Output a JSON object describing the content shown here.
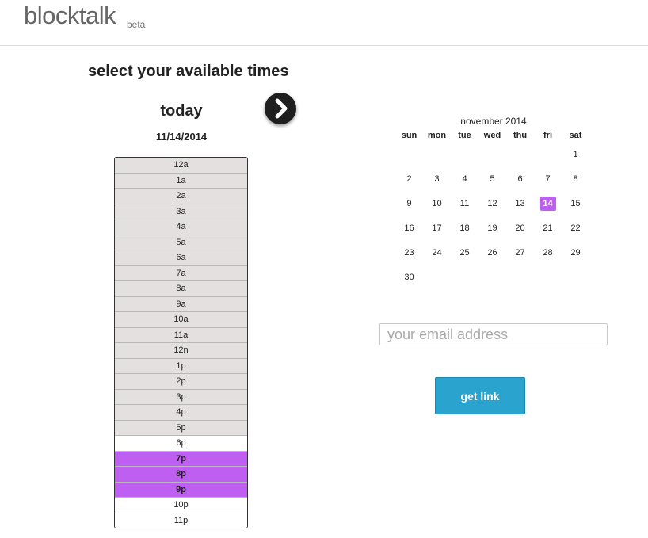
{
  "header": {
    "logo": "blocktalk",
    "badge": "beta"
  },
  "heading": "select your available times",
  "day": {
    "label": "today",
    "date": "11/14/2014"
  },
  "slots": [
    {
      "label": "12a",
      "state": "busy"
    },
    {
      "label": "1a",
      "state": "busy"
    },
    {
      "label": "2a",
      "state": "busy"
    },
    {
      "label": "3a",
      "state": "busy"
    },
    {
      "label": "4a",
      "state": "busy"
    },
    {
      "label": "5a",
      "state": "busy"
    },
    {
      "label": "6a",
      "state": "busy"
    },
    {
      "label": "7a",
      "state": "busy"
    },
    {
      "label": "8a",
      "state": "busy"
    },
    {
      "label": "9a",
      "state": "busy"
    },
    {
      "label": "10a",
      "state": "busy"
    },
    {
      "label": "11a",
      "state": "busy"
    },
    {
      "label": "12n",
      "state": "busy"
    },
    {
      "label": "1p",
      "state": "busy"
    },
    {
      "label": "2p",
      "state": "busy"
    },
    {
      "label": "3p",
      "state": "busy"
    },
    {
      "label": "4p",
      "state": "busy"
    },
    {
      "label": "5p",
      "state": "busy"
    },
    {
      "label": "6p",
      "state": "free"
    },
    {
      "label": "7p",
      "state": "selected"
    },
    {
      "label": "8p",
      "state": "selected"
    },
    {
      "label": "9p",
      "state": "selected"
    },
    {
      "label": "10p",
      "state": "free"
    },
    {
      "label": "11p",
      "state": "free"
    }
  ],
  "calendar": {
    "title": "november 2014",
    "weekdays": [
      "sun",
      "mon",
      "tue",
      "wed",
      "thu",
      "fri",
      "sat"
    ],
    "days": [
      "",
      "",
      "",
      "",
      "",
      "",
      "1",
      "2",
      "3",
      "4",
      "5",
      "6",
      "7",
      "8",
      "9",
      "10",
      "11",
      "12",
      "13",
      "14",
      "15",
      "16",
      "17",
      "18",
      "19",
      "20",
      "21",
      "22",
      "23",
      "24",
      "25",
      "26",
      "27",
      "28",
      "29",
      "30"
    ],
    "today": "14"
  },
  "email": {
    "placeholder": "your email address",
    "value": ""
  },
  "get_link_label": "get link",
  "colors": {
    "selected": "#bf5ff2",
    "busy": "#e4e0e0",
    "button": "#2ba3cf"
  },
  "icons": {
    "next": "chevron-right-icon"
  }
}
